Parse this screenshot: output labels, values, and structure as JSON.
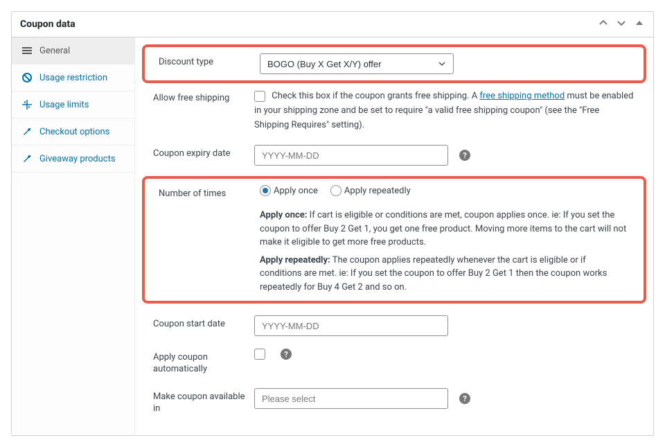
{
  "panel": {
    "title": "Coupon data"
  },
  "tabs": {
    "general": "General",
    "usage_restriction": "Usage restriction",
    "usage_limits": "Usage limits",
    "checkout_options": "Checkout options",
    "giveaway_products": "Giveaway products"
  },
  "fields": {
    "discount_type": {
      "label": "Discount type",
      "value": "BOGO (Buy X Get X/Y) offer"
    },
    "allow_free_shipping": {
      "label": "Allow free shipping",
      "desc_prefix": "Check this box if the coupon grants free shipping. A ",
      "link_text": "free shipping method",
      "desc_suffix": " must be enabled in your shipping zone and be set to require \"a valid free shipping coupon\" (see the \"Free Shipping Requires\" setting)."
    },
    "coupon_expiry": {
      "label": "Coupon expiry date",
      "placeholder": "YYYY-MM-DD"
    },
    "number_of_times": {
      "label": "Number of times",
      "opt_once": "Apply once",
      "opt_rep": "Apply repeatedly",
      "note_once_label": "Apply once:",
      "note_once": " If cart is eligible or conditions are met, coupon applies once. ie: If you set the coupon to offer Buy 2 Get 1, you get one free product. Moving more items to the cart will not make it eligible to get more free products.",
      "note_rep_label": "Apply repeatedly:",
      "note_rep": " The coupon applies repeatedly whenever the cart is eligible or if conditions are met. ie: If you set the coupon to offer Buy 2 Get 1 then the coupon works repeatedly for Buy 4 Get 2 and so on."
    },
    "coupon_start": {
      "label": "Coupon start date",
      "placeholder": "YYYY-MM-DD"
    },
    "apply_auto": {
      "label": "Apply coupon automatically"
    },
    "available_in": {
      "label": "Make coupon available in",
      "placeholder": "Please select"
    }
  }
}
